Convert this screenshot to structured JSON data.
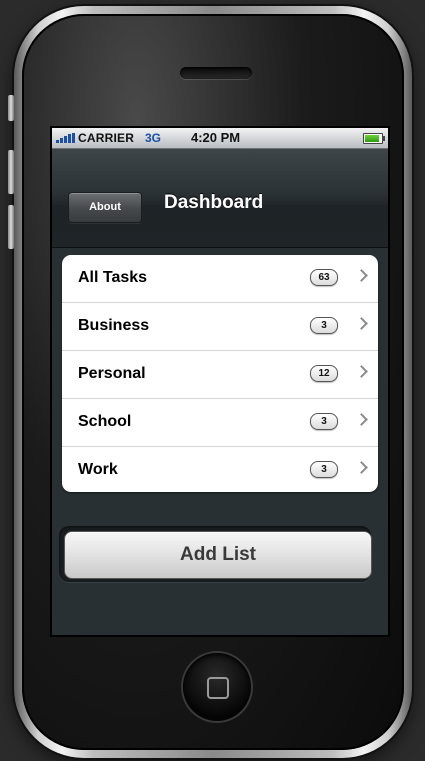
{
  "status_bar": {
    "carrier": "CARRIER",
    "network": "3G",
    "time": "4:20 PM",
    "battery_level": 0.9
  },
  "nav_bar": {
    "back_label": "About",
    "title": "Dashboard"
  },
  "lists": [
    {
      "label": "All Tasks",
      "count": "63"
    },
    {
      "label": "Business",
      "count": "3"
    },
    {
      "label": "Personal",
      "count": "12"
    },
    {
      "label": "School",
      "count": "3"
    },
    {
      "label": "Work",
      "count": "3"
    }
  ],
  "actions": {
    "add_list_label": "Add List"
  },
  "icons": {
    "signal": "signal-bars-icon",
    "battery": "battery-icon",
    "chevron": "chevron-right-icon",
    "home": "home-button-icon"
  },
  "colors": {
    "nav_background": "#2b3236",
    "screen_background": "#283033",
    "network_text": "#1a50a8",
    "battery_fill": "#4cb825"
  }
}
